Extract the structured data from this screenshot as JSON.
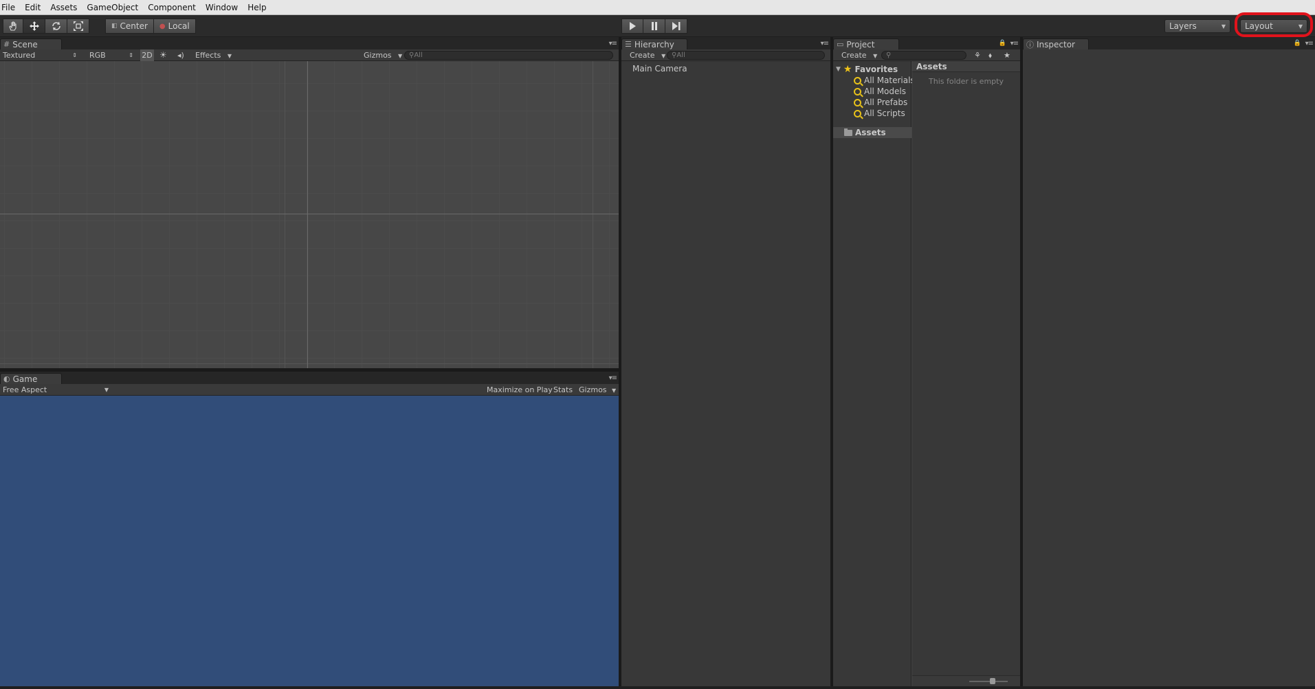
{
  "menu": [
    "File",
    "Edit",
    "Assets",
    "GameObject",
    "Component",
    "Window",
    "Help"
  ],
  "toolbar": {
    "pivot_center": "Center",
    "pivot_local": "Local",
    "layers": "Layers",
    "layout": "Layout"
  },
  "scene": {
    "tab": "Scene",
    "render_mode": "Textured",
    "color_mode": "RGB",
    "mode_2d": "2D",
    "effects": "Effects",
    "gizmos": "Gizmos",
    "search_placeholder": "All"
  },
  "game": {
    "tab": "Game",
    "aspect": "Free Aspect",
    "maximize": "Maximize on Play",
    "stats": "Stats",
    "gizmos": "Gizmos",
    "background_color": "#314d79"
  },
  "hierarchy": {
    "tab": "Hierarchy",
    "create": "Create",
    "search_placeholder": "All",
    "items": [
      "Main Camera"
    ]
  },
  "project": {
    "tab": "Project",
    "create": "Create",
    "favorites": "Favorites",
    "favorite_items": [
      "All Materials",
      "All Models",
      "All Prefabs",
      "All Scripts"
    ],
    "assets_root": "Assets",
    "assets_header": "Assets",
    "empty_message": "This folder is empty"
  },
  "inspector": {
    "tab": "Inspector"
  },
  "colors": {
    "highlight": "#e0131c"
  }
}
